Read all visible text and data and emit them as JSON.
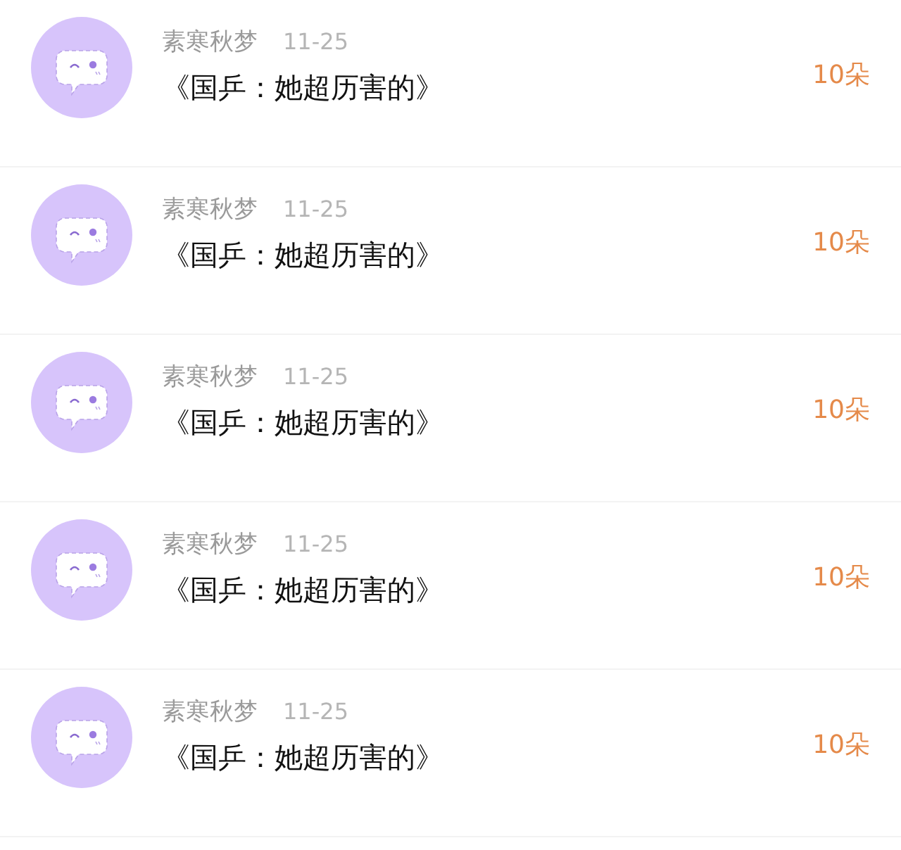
{
  "items": [
    {
      "user": "素寒秋梦",
      "date": "11-25",
      "title": "《国乒：她超历害的》",
      "count": "10朵"
    },
    {
      "user": "素寒秋梦",
      "date": "11-25",
      "title": "《国乒：她超历害的》",
      "count": "10朵"
    },
    {
      "user": "素寒秋梦",
      "date": "11-25",
      "title": "《国乒：她超历害的》",
      "count": "10朵"
    },
    {
      "user": "素寒秋梦",
      "date": "11-25",
      "title": "《国乒：她超历害的》",
      "count": "10朵"
    },
    {
      "user": "素寒秋梦",
      "date": "11-25",
      "title": "《国乒：她超历害的》",
      "count": "10朵"
    }
  ]
}
